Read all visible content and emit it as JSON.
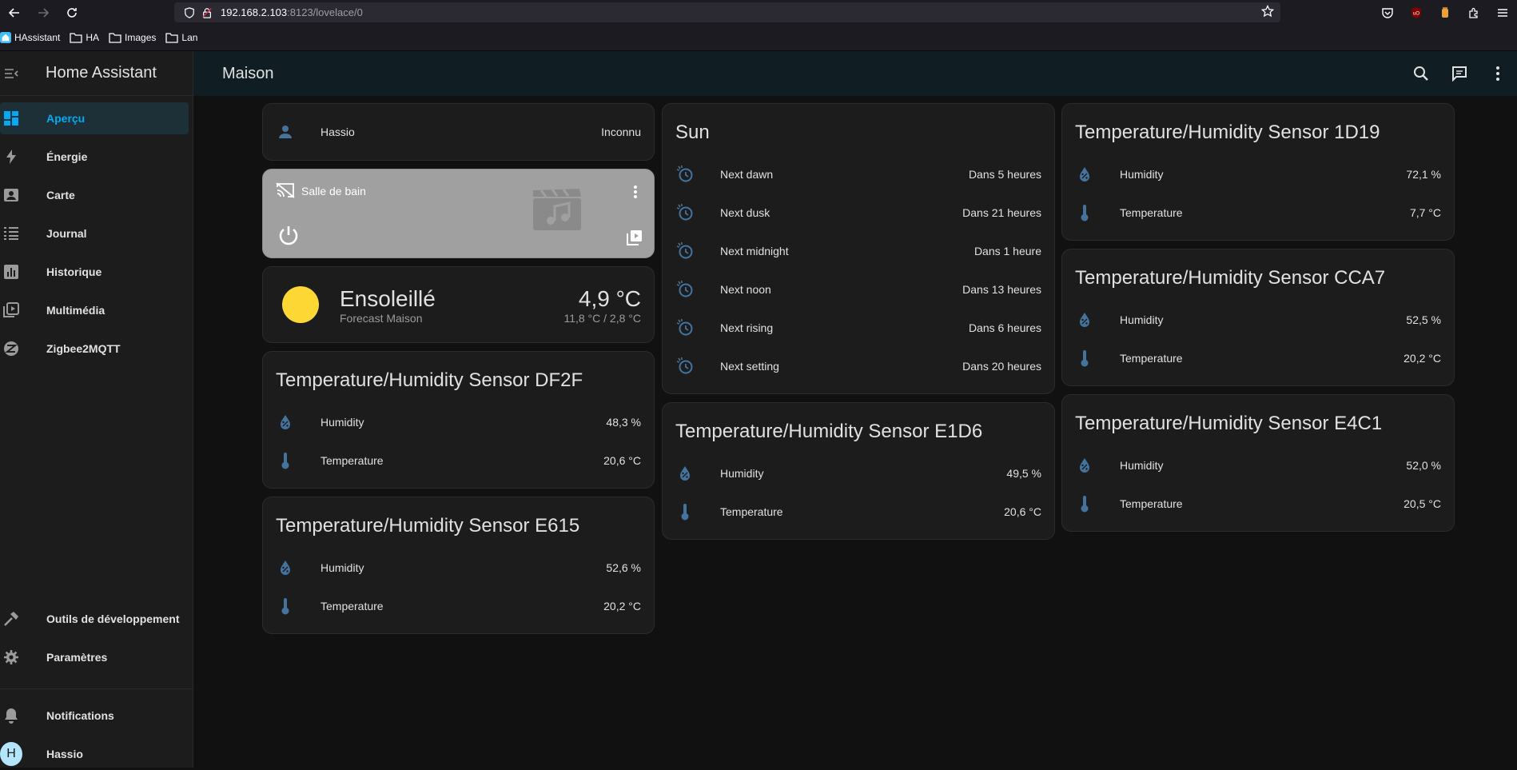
{
  "browser": {
    "url_host": "192.168.2.103",
    "url_path": ":8123/lovelace/0",
    "bookmarks": [
      "HAssistant",
      "HA",
      "Images",
      "Lan"
    ]
  },
  "sidebar": {
    "title": "Home Assistant",
    "items": [
      {
        "label": "Aperçu",
        "icon": "dashboard-icon",
        "active": true
      },
      {
        "label": "Énergie",
        "icon": "lightning-icon",
        "active": false
      },
      {
        "label": "Carte",
        "icon": "map-icon",
        "active": false
      },
      {
        "label": "Journal",
        "icon": "list-icon",
        "active": false
      },
      {
        "label": "Historique",
        "icon": "chart-icon",
        "active": false
      },
      {
        "label": "Multimédia",
        "icon": "media-icon",
        "active": false
      },
      {
        "label": "Zigbee2MQTT",
        "icon": "zigbee-icon",
        "active": false
      }
    ],
    "bottom_items": [
      {
        "label": "Outils de développement",
        "icon": "hammer-icon"
      },
      {
        "label": "Paramètres",
        "icon": "gear-icon"
      }
    ],
    "notifications": "Notifications",
    "user": {
      "name": "Hassio",
      "initial": "H"
    }
  },
  "topbar": {
    "title": "Maison"
  },
  "colors": {
    "accent": "#03a9f4",
    "state_icon": "#44739e",
    "sun": "#fdd835"
  },
  "cards": {
    "person": {
      "name": "Hassio",
      "state": "Inconnu"
    },
    "media": {
      "name": "Salle de bain"
    },
    "weather": {
      "condition": "Ensoleillé",
      "location": "Forecast Maison",
      "temperature": "4,9 °C",
      "range": "11,8 °C / 2,8 °C"
    },
    "sensor_df2f": {
      "title": "Temperature/Humidity Sensor DF2F",
      "humidity_label": "Humidity",
      "humidity": "48,3 %",
      "temperature_label": "Temperature",
      "temperature": "20,6 °C"
    },
    "sensor_e615": {
      "title": "Temperature/Humidity Sensor E615",
      "humidity_label": "Humidity",
      "humidity": "52,6 %",
      "temperature_label": "Temperature",
      "temperature": "20,2 °C"
    },
    "sun": {
      "title": "Sun",
      "rows": [
        {
          "label": "Next dawn",
          "value": "Dans 5 heures"
        },
        {
          "label": "Next dusk",
          "value": "Dans 21 heures"
        },
        {
          "label": "Next midnight",
          "value": "Dans 1 heure"
        },
        {
          "label": "Next noon",
          "value": "Dans 13 heures"
        },
        {
          "label": "Next rising",
          "value": "Dans 6 heures"
        },
        {
          "label": "Next setting",
          "value": "Dans 20 heures"
        }
      ]
    },
    "sensor_e1d6": {
      "title": "Temperature/Humidity Sensor E1D6",
      "humidity_label": "Humidity",
      "humidity": "49,5 %",
      "temperature_label": "Temperature",
      "temperature": "20,6 °C"
    },
    "sensor_1d19": {
      "title": "Temperature/Humidity Sensor 1D19",
      "humidity_label": "Humidity",
      "humidity": "72,1 %",
      "temperature_label": "Temperature",
      "temperature": "7,7 °C"
    },
    "sensor_cca7": {
      "title": "Temperature/Humidity Sensor CCA7",
      "humidity_label": "Humidity",
      "humidity": "52,5 %",
      "temperature_label": "Temperature",
      "temperature": "20,2 °C"
    },
    "sensor_e4c1": {
      "title": "Temperature/Humidity Sensor E4C1",
      "humidity_label": "Humidity",
      "humidity": "52,0 %",
      "temperature_label": "Temperature",
      "temperature": "20,5 °C"
    }
  }
}
